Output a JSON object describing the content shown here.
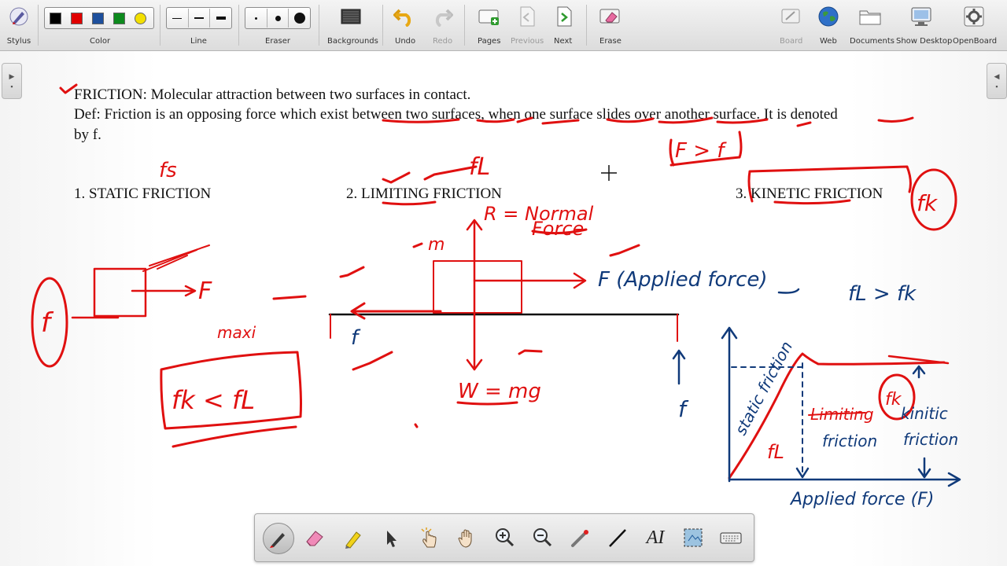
{
  "toolbar": {
    "stylus": "Stylus",
    "color": "Color",
    "line": "Line",
    "eraser": "Eraser",
    "backgrounds": "Backgrounds",
    "undo": "Undo",
    "redo": "Redo",
    "pages": "Pages",
    "previous": "Previous",
    "next": "Next",
    "erase": "Erase",
    "board": "Board",
    "web": "Web",
    "documents": "Documents",
    "show_desktop": "Show Desktop",
    "openboard": "OpenBoard"
  },
  "colors": {
    "swatches": [
      "#000000",
      "#e00000",
      "#1d4f9c",
      "#0d8a1e",
      "#f3e000"
    ],
    "ink_red": "#e01010",
    "ink_blue": "#103a7a"
  },
  "page": {
    "line1": "FRICTION: Molecular attraction between two surfaces in contact.",
    "line2": "Def: Friction is an opposing force which exist between two surfaces, when one surface slides over another surface. It is denoted",
    "line3": "by f.",
    "heading1": "1. STATIC FRICTION",
    "heading2": "2. LIMITING FRICTION",
    "heading3": "3. KINETIC FRICTION"
  },
  "handwriting": {
    "fs": "fs",
    "fl": "fL",
    "fk_circle": "fk",
    "f_gt_f": "F > f",
    "r_normal": "R = Normal",
    "force": "Force",
    "m": "m",
    "f_applied": "F (Applied force)",
    "f_left": "f",
    "w_mg": "W = mg",
    "f_side": "f",
    "maxi": "maxi",
    "fk_lt_fl": "fk < fL",
    "fl_gt_fk": "fL > fk",
    "static_friction": "static friction",
    "limiting": "Limiting",
    "friction": "friction",
    "kinetic": "kinitic",
    "friction2": "friction",
    "fl_circle": "fL",
    "fk_graph": "fk",
    "applied_force_axis": "Applied force (F)",
    "F_left": "F",
    "f_circle_left": "f"
  },
  "palette": {
    "icons": [
      "pen-icon",
      "eraser-icon",
      "marker-icon",
      "selector-icon",
      "interact-icon",
      "hand-icon",
      "zoom-in-icon",
      "zoom-out-icon",
      "laser-pointer-icon",
      "line-icon",
      "text-icon",
      "capture-icon",
      "keyboard-icon"
    ],
    "text_tool": "AI"
  }
}
